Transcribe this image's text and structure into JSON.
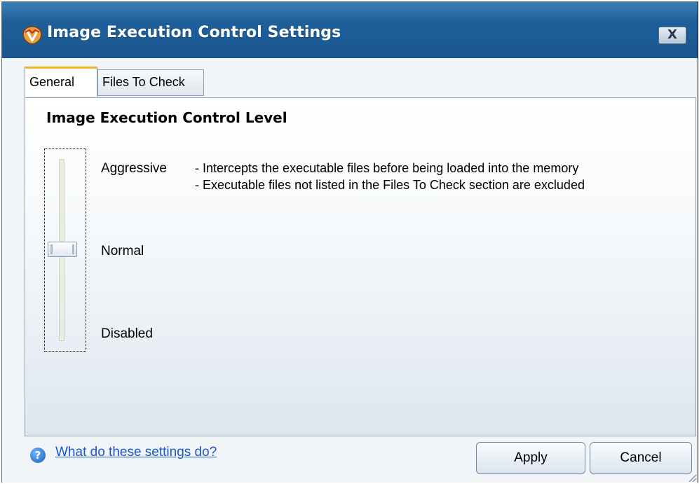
{
  "window": {
    "title": "Image Execution Control Settings",
    "close_label": "X"
  },
  "tabs": [
    {
      "label": "General",
      "active": true
    },
    {
      "label": "Files To Check",
      "active": false
    }
  ],
  "general": {
    "section_title": "Image Execution Control Level",
    "levels": [
      {
        "label": "Aggressive"
      },
      {
        "label": "Normal"
      },
      {
        "label": "Disabled"
      }
    ],
    "selected_level": "Normal",
    "description_lines": [
      "- Intercepts the executable files before being loaded into the memory",
      "- Executable files not listed in the Files To Check section are excluded"
    ]
  },
  "footer": {
    "help_link": "What do these settings do?",
    "apply_label": "Apply",
    "cancel_label": "Cancel"
  },
  "colors": {
    "titlebar": "#1f5f99",
    "tab_accent": "#f0b62a",
    "link": "#1a57c8"
  },
  "icons": {
    "title": "comodo-shield-icon",
    "help": "question-circle-icon",
    "close": "close-icon"
  }
}
